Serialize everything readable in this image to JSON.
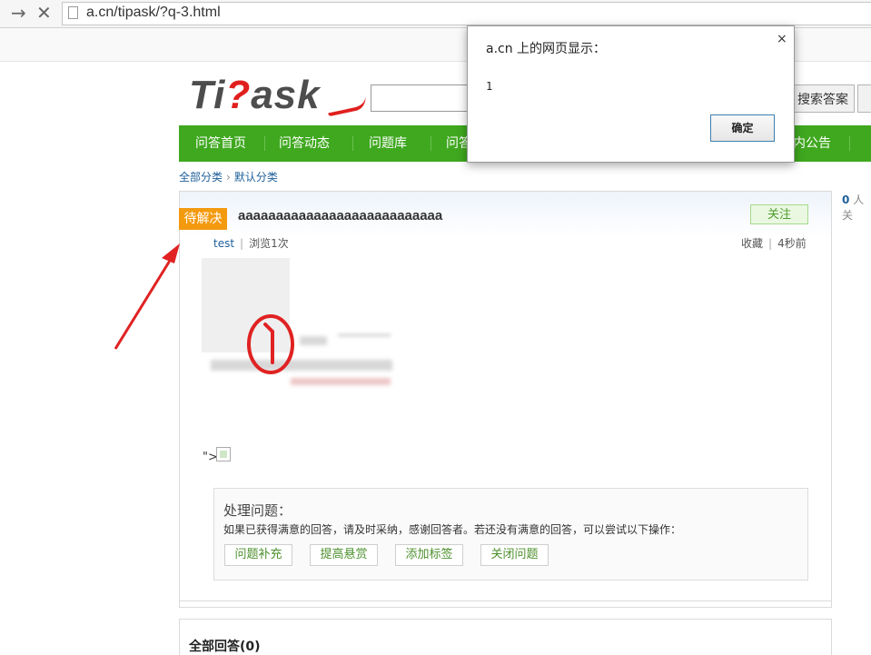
{
  "browser": {
    "url": "a.cn/tipask/?q-3.html",
    "forward_icon": "arrow-right-icon",
    "stop_icon": "close-icon"
  },
  "site": {
    "logo_prefix": "Ti",
    "logo_q": "?",
    "logo_suffix": "ask",
    "search_button": "搜索答案",
    "nav": [
      "问答首页",
      "问答动态",
      "问题库",
      "问答",
      "内公告"
    ],
    "colors": {
      "nav_green": "#3fa81f",
      "status_orange": "#f39a0f",
      "logo_red": "#e0201e"
    }
  },
  "breadcrumb": {
    "root": "全部分类",
    "current": "默认分类"
  },
  "question": {
    "status": "待解决",
    "title": "aaaaaaaaaaaaaaaaaaaaaaaaaaa",
    "follow_button": "关注",
    "user": "test",
    "views": "浏览1次",
    "favorite": "收藏",
    "time": "4秒前",
    "right_follow_count": "0",
    "right_follow_text": "人关",
    "broken_tail": "\">"
  },
  "handle": {
    "title": "处理问题：",
    "text": "如果已获得满意的回答，请及时采纳，感谢回答者。若还没有满意的回答，可以尝试以下操作：",
    "buttons": [
      "问题补充",
      "提高悬赏",
      "添加标签",
      "关闭问题"
    ]
  },
  "answers": {
    "header": "全部回答(0)"
  },
  "dialog": {
    "title": "a.cn 上的网页显示：",
    "message": "1",
    "ok": "确定",
    "close": "×"
  }
}
